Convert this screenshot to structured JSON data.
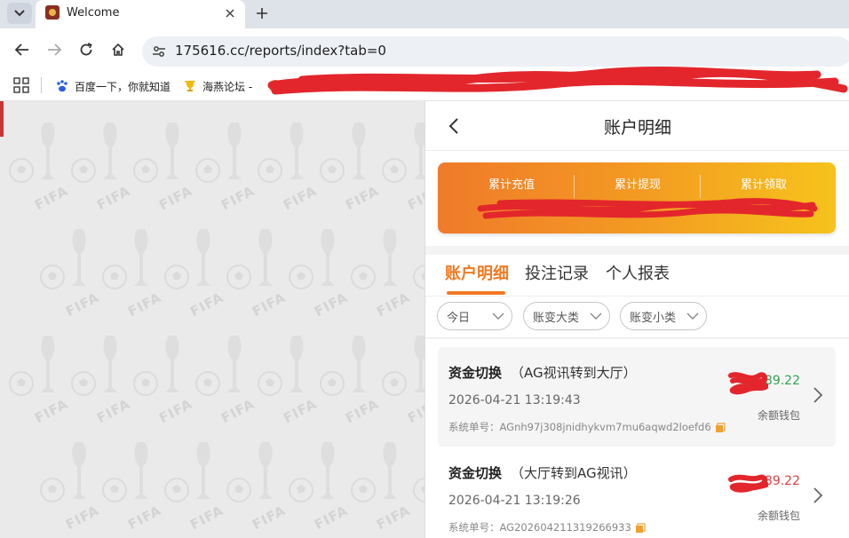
{
  "browser": {
    "tab_title": "Welcome",
    "url": "175616.cc/reports/index?tab=0",
    "bookmarks": [
      {
        "label": "百度一下，你就知道",
        "icon": "baidu-paw-icon"
      },
      {
        "label": "海燕论坛 -",
        "icon": "trophy-icon"
      }
    ]
  },
  "background": {
    "watermark_text": "FIFA"
  },
  "app": {
    "header_title": "账户明细",
    "summary": {
      "items": [
        {
          "label": "累计充值"
        },
        {
          "label": "累计提现"
        },
        {
          "label": "累计领取"
        }
      ]
    },
    "tabs": [
      {
        "label": "账户明细",
        "active": true
      },
      {
        "label": "投注记录",
        "active": false
      },
      {
        "label": "个人报表",
        "active": false
      }
    ],
    "filters": [
      {
        "label": "今日"
      },
      {
        "label": "账变大类"
      },
      {
        "label": "账变小类"
      }
    ],
    "records": [
      {
        "type": "资金切换",
        "note": "（AG视讯转到大厅）",
        "time": "2026-04-21 13:19:43",
        "order_label": "系统单号：",
        "order_no": "AGnh97j308jnidhykvm7mu6aqwd2loefd6",
        "amount_visible": "89.22",
        "wallet": "余额钱包"
      },
      {
        "type": "资金切换",
        "note": "（大厅转到AG视讯）",
        "time": "2026-04-21 13:19:26",
        "order_label": "系统单号：",
        "order_no": "AG202604211319266933",
        "amount_visible": "89.22",
        "wallet": "余额钱包"
      }
    ]
  },
  "colors": {
    "accent": "#f07a22",
    "positive": "#2ea44f",
    "negative": "#e04040",
    "redaction": "#e3262c"
  }
}
